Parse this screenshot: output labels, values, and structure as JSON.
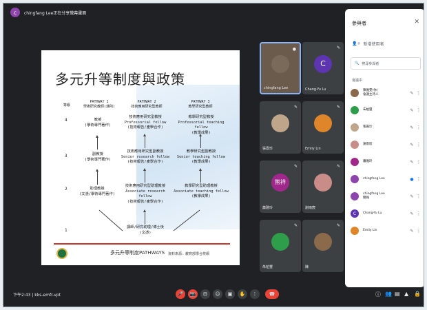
{
  "top": {
    "presenter_title": "chingfang Lee正在分享螢幕畫面",
    "presenter_initial": "c"
  },
  "slide": {
    "title": "多元升等制度與政策",
    "pathways": [
      {
        "head": "PATHWAY 1",
        "sub": "學術研究教師(通則)"
      },
      {
        "head": "PATHWAY 2",
        "sub": "技術應用研究型教師"
      },
      {
        "head": "PATHWAY 3",
        "sub": "教學研究型教師"
      }
    ],
    "level_header": "等級",
    "levels": [
      "4",
      "3",
      "2",
      "1"
    ],
    "rows": [
      [
        "教授\n(學術專門著作)",
        "技術應用研究型教授\nProfessorial fellow\n(技術報告/產學合作)",
        "教學研究型教授\nProfessorial teaching fellow\n(教學成果)"
      ],
      [
        "副教授\n(學術專門著作)",
        "技術應用研究型副教授\nSenior research fellow\n(技術報告/產學合作)",
        "教學研究型副教授\nSenior teaching fellow\n(教學成果)"
      ],
      [
        "助理教授\n(文憑/學術專門著作)",
        "技術應用研究型助理教授\nAssociate research\nfellow\n(技術報告/產學合作)",
        "教學研究型助理教授\nAssociate teaching fellow\n(教學成果)"
      ],
      [
        "",
        "講師/研究助理/博士後\n(文憑)",
        ""
      ]
    ],
    "footer": "多元升等制度PATHWAYS",
    "source": "資料來源：教育部學合校網"
  },
  "tiles": [
    {
      "name": "chingfang Lee",
      "mic": "●",
      "avatar": "",
      "color": "#7a6a5a"
    },
    {
      "name": "Chang-Yu Lu",
      "mic": "✎",
      "avatar": "C",
      "color": "#5e35b1"
    },
    {
      "name": "張嘉珍",
      "mic": "✎",
      "avatar": "",
      "color": "#bfa68a"
    },
    {
      "name": "Emily Lin",
      "mic": "✎",
      "avatar": "",
      "color": "#e0862a"
    },
    {
      "name": "蕭雅玲",
      "mic": "✎",
      "avatar": "熊祥",
      "color": "#a0288c"
    },
    {
      "name": "謝雨宸",
      "mic": "✎",
      "avatar": "",
      "color": "#c98c88"
    },
    {
      "name": "朱柏璽",
      "mic": "✎",
      "avatar": "",
      "color": "#2e9e4a"
    },
    {
      "name": "陳",
      "mic": "✎",
      "avatar": "",
      "color": "#8a6a4a"
    }
  ],
  "panel": {
    "title": "參與者",
    "close": "✕",
    "add_people": "新增使用者",
    "search_placeholder": "搜尋參與者",
    "section": "會議中",
    "participants": [
      {
        "name": "陳雅雯(你)\n會議主持人",
        "initial": "",
        "color": "#8a6a4a",
        "mic": "✎"
      },
      {
        "name": "朱柏璽",
        "initial": "",
        "color": "#2e9e4a",
        "mic": "✎"
      },
      {
        "name": "張嘉珍",
        "initial": "",
        "color": "#bfa68a",
        "mic": "✎"
      },
      {
        "name": "謝雨宸",
        "initial": "",
        "color": "#c98c88",
        "mic": "✎"
      },
      {
        "name": "蕭雅玲",
        "initial": "",
        "color": "#a0288c",
        "mic": "✎"
      },
      {
        "name": "chingfang Lee",
        "initial": "",
        "color": "#8e44ad",
        "mic": "●"
      },
      {
        "name": "chingfang Lee\n簡報",
        "initial": "",
        "color": "#8e44ad",
        "mic": "✎"
      },
      {
        "name": "Chang-Yu Lu",
        "initial": "C",
        "color": "#5e35b1",
        "mic": "✎"
      },
      {
        "name": "Emily Lin",
        "initial": "",
        "color": "#e0862a",
        "mic": "✎"
      }
    ]
  },
  "bottom": {
    "time_code": "下午2:43 | kks-emfr-vpt",
    "controls": [
      "🎤",
      "📷",
      "⊟",
      "☺",
      "▣",
      "✋",
      "⋮",
      "☎"
    ],
    "right_controls": [
      "ⓘ",
      "👥",
      "▤",
      "▲",
      "🔒"
    ]
  }
}
